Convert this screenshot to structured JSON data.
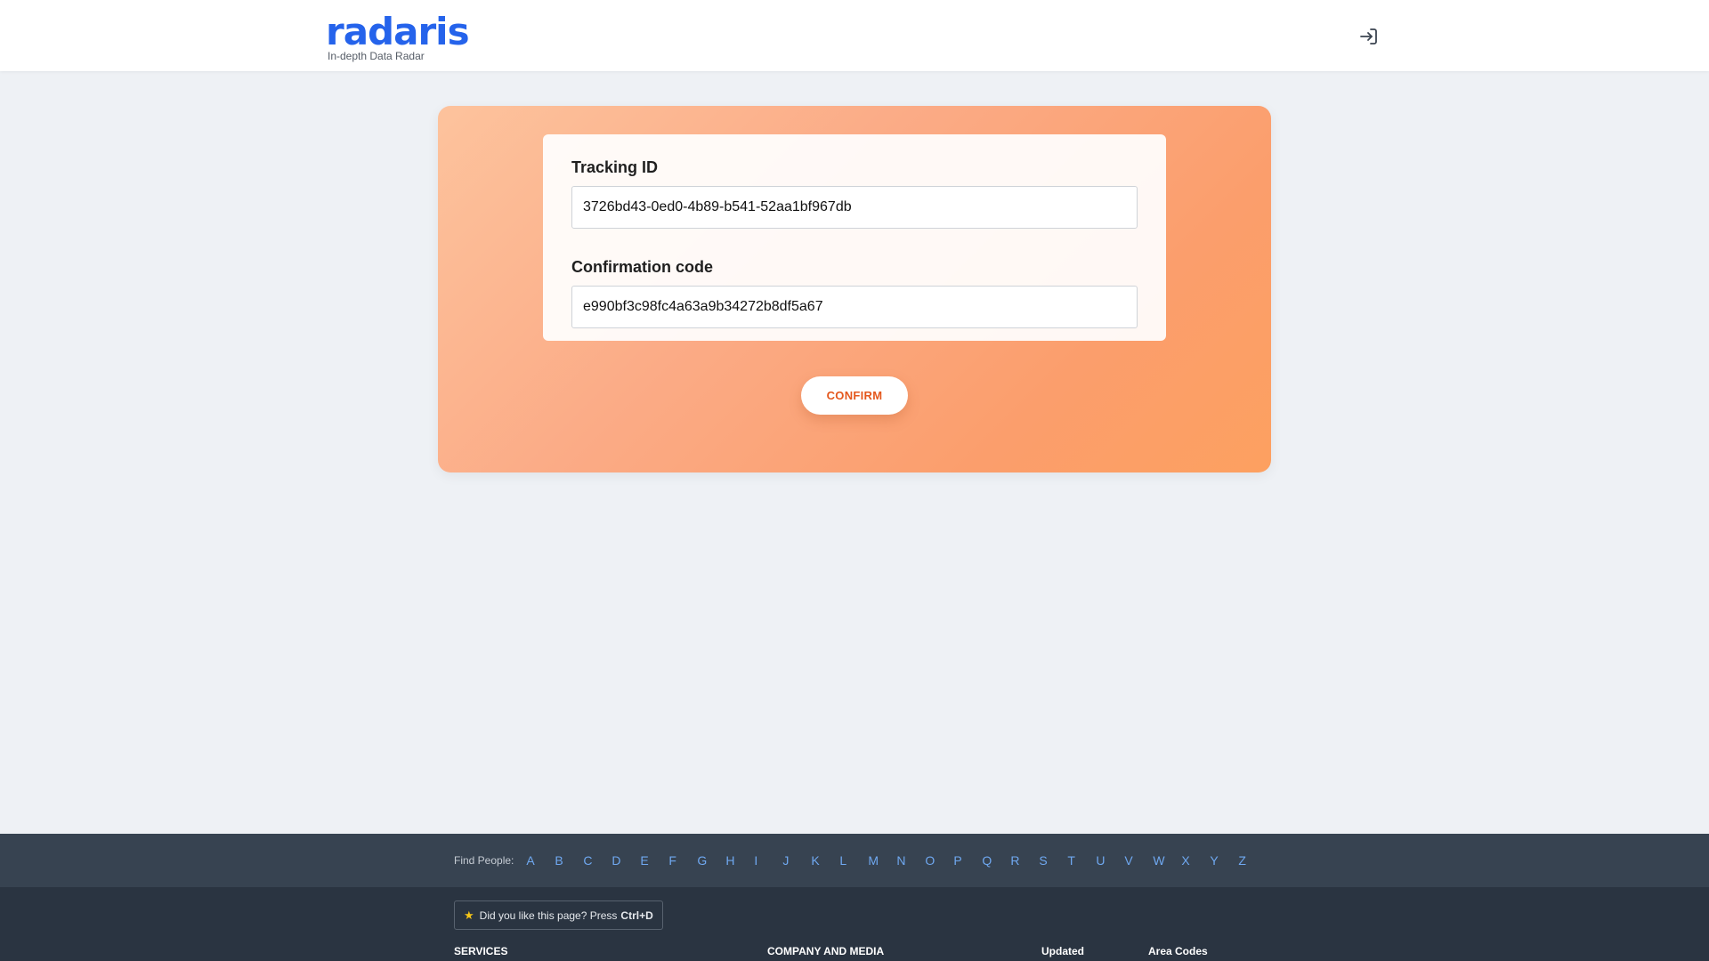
{
  "header": {
    "logo_text": "radaris",
    "tagline": "In-depth Data Radar",
    "login_icon": "login-icon"
  },
  "form": {
    "tracking_label": "Tracking ID",
    "tracking_value": "3726bd43-0ed0-4b89-b541-52aa1bf967db",
    "confirmation_label": "Confirmation code",
    "confirmation_value": "e990bf3c98fc4a63a9b34272b8df5a67",
    "confirm_button": "CONFIRM"
  },
  "footer": {
    "find_people_label": "Find People:",
    "letters": [
      "A",
      "B",
      "C",
      "D",
      "E",
      "F",
      "G",
      "H",
      "I",
      "J",
      "K",
      "L",
      "M",
      "N",
      "O",
      "P",
      "Q",
      "R",
      "S",
      "T",
      "U",
      "V",
      "W",
      "X",
      "Y",
      "Z"
    ],
    "bookmark_text": "Did you like this page? Press",
    "bookmark_shortcut": "Ctrl+D",
    "columns": [
      "SERVICES",
      "COMPANY AND MEDIA",
      "Updated",
      "Area Codes"
    ]
  },
  "colors": {
    "brand": "#2563eb",
    "accent": "#e4571c",
    "footer_bg": "#2a3441",
    "link": "#6fa8f0"
  }
}
